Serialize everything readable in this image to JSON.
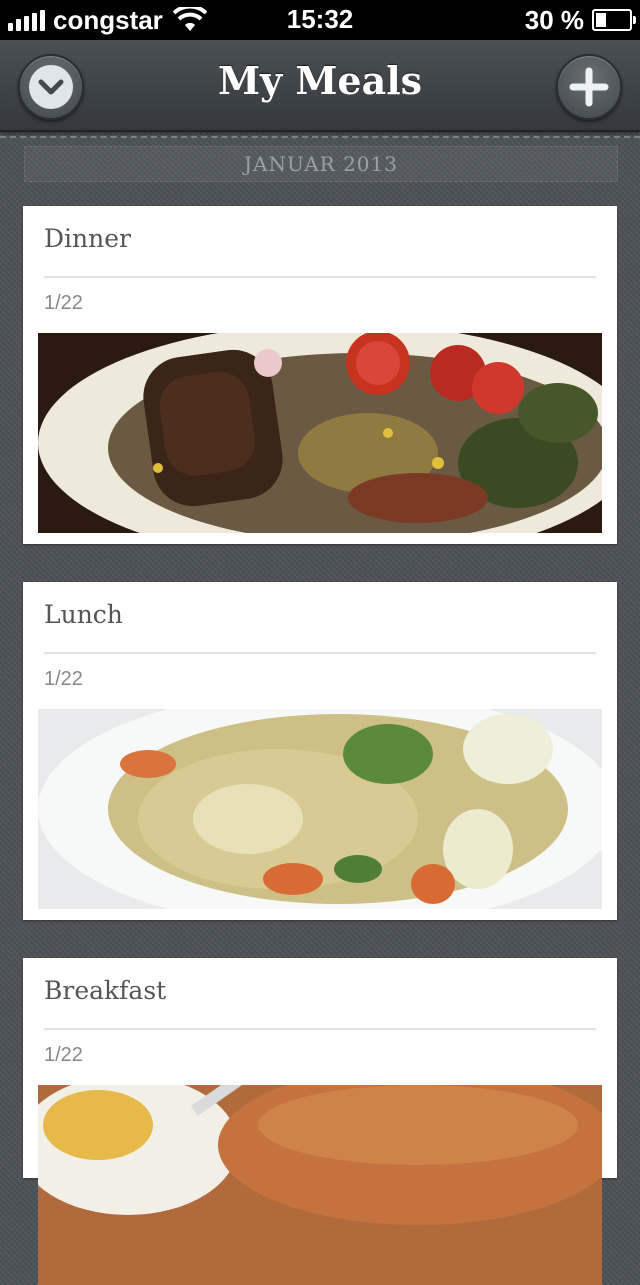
{
  "status_bar": {
    "carrier": "congstar",
    "time": "15:32",
    "battery": "30 %",
    "battery_level": 0.3
  },
  "nav": {
    "title": "My Meals",
    "left_icon": "chevron-down-icon",
    "right_icon": "plus-icon"
  },
  "section": {
    "header": "JANUAR 2013"
  },
  "meals": [
    {
      "title": "Dinner",
      "date": "1/22",
      "photo": "steak-salad-photo"
    },
    {
      "title": "Lunch",
      "date": "1/22",
      "photo": "noodle-vegetable-photo"
    },
    {
      "title": "Breakfast",
      "date": "1/22",
      "photo": "breakfast-photo"
    }
  ],
  "colors": {
    "background": "#4b5156",
    "navbar": "#3e4348",
    "card": "#ffffff",
    "title_text": "#555555",
    "date_text": "#888888"
  }
}
